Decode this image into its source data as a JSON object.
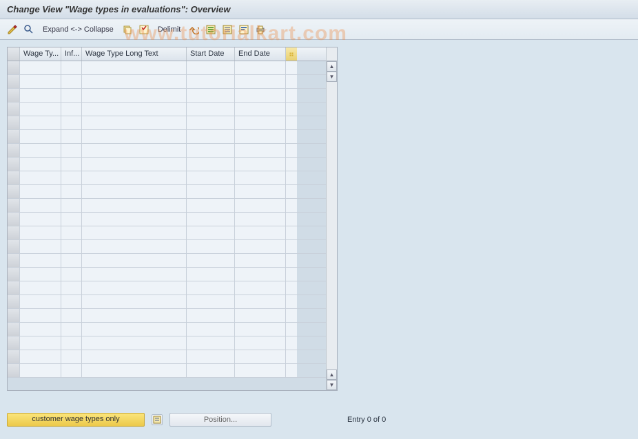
{
  "title": "Change View \"Wage types in evaluations\": Overview",
  "toolbar": {
    "expand_collapse": "Expand <-> Collapse",
    "delimit": "Delimit"
  },
  "columns": {
    "wage_type": "Wage Ty...",
    "inf": "Inf...",
    "long_text": "Wage Type Long Text",
    "start_date": "Start Date",
    "end_date": "End Date"
  },
  "buttons": {
    "customer_wage": "customer wage types only",
    "position": "Position..."
  },
  "status": {
    "entry": "Entry 0 of 0"
  },
  "watermark": "www.tutorialkart.com"
}
